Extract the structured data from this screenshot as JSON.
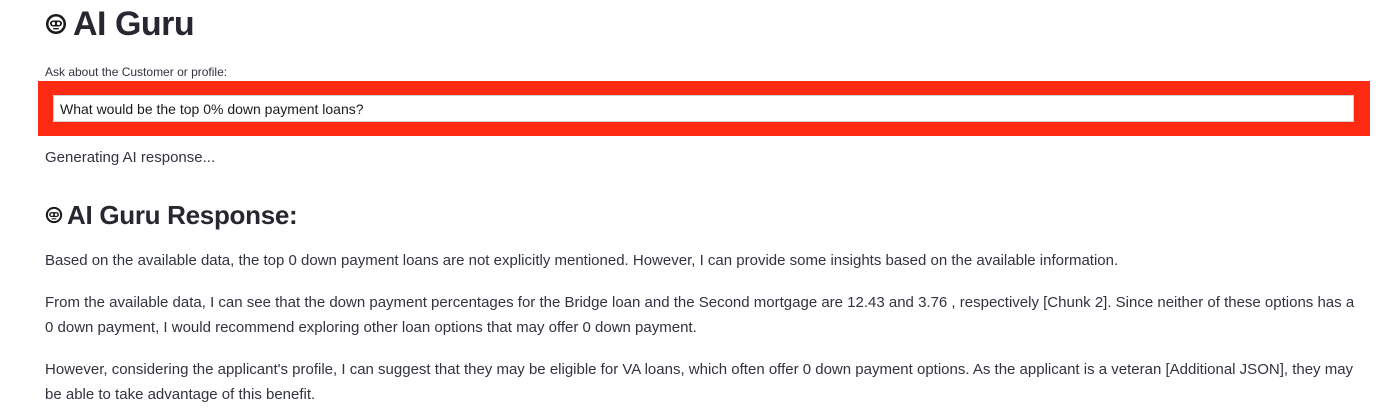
{
  "app": {
    "title": "AI Guru",
    "title_icon": "robot-face-icon"
  },
  "query": {
    "label": "Ask about the Customer or profile:",
    "value": "What would be the top 0% down payment loans?",
    "highlight_color": "#ff2a12"
  },
  "status": {
    "text": "Generating AI response..."
  },
  "response": {
    "heading": "AI Guru Response:",
    "heading_icon": "robot-face-icon",
    "paragraphs": [
      "Based on the available data, the top 0 down payment loans are not explicitly mentioned. However, I can provide some insights based on the available information.",
      "From the available data, I can see that the down payment percentages for the Bridge loan and the Second mortgage are 12.43 and 3.76 , respectively [Chunk 2]. Since neither of these options has a 0 down payment, I would recommend exploring other loan options that may offer 0 down payment.",
      "However, considering the applicant's profile, I can suggest that they may be eligible for VA loans, which often offer 0 down payment options. As the applicant is a veteran [Additional JSON], they may be able to take advantage of this benefit."
    ]
  }
}
